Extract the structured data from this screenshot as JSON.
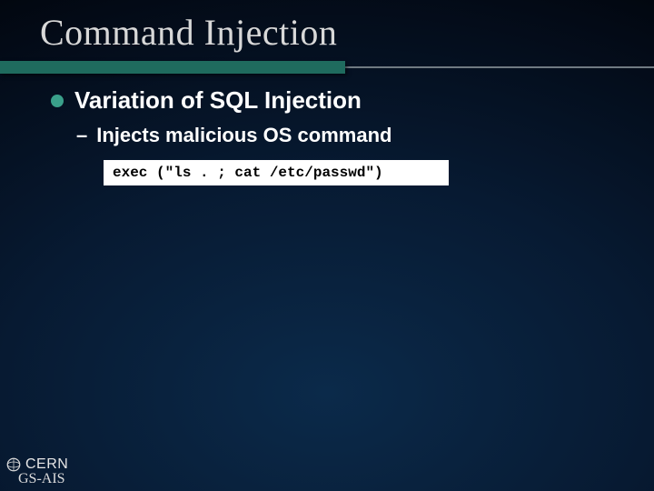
{
  "title": "Command Injection",
  "bullet": {
    "text": "Variation of SQL Injection"
  },
  "sub": {
    "dash": "–",
    "text": "Injects malicious OS command"
  },
  "code": "exec (\"ls . ; cat /etc/passwd\")",
  "footer": {
    "org": "CERN",
    "dept": "GS-AIS"
  },
  "colors": {
    "accent": "#1f6b5e",
    "bullet": "#3aa08a"
  }
}
